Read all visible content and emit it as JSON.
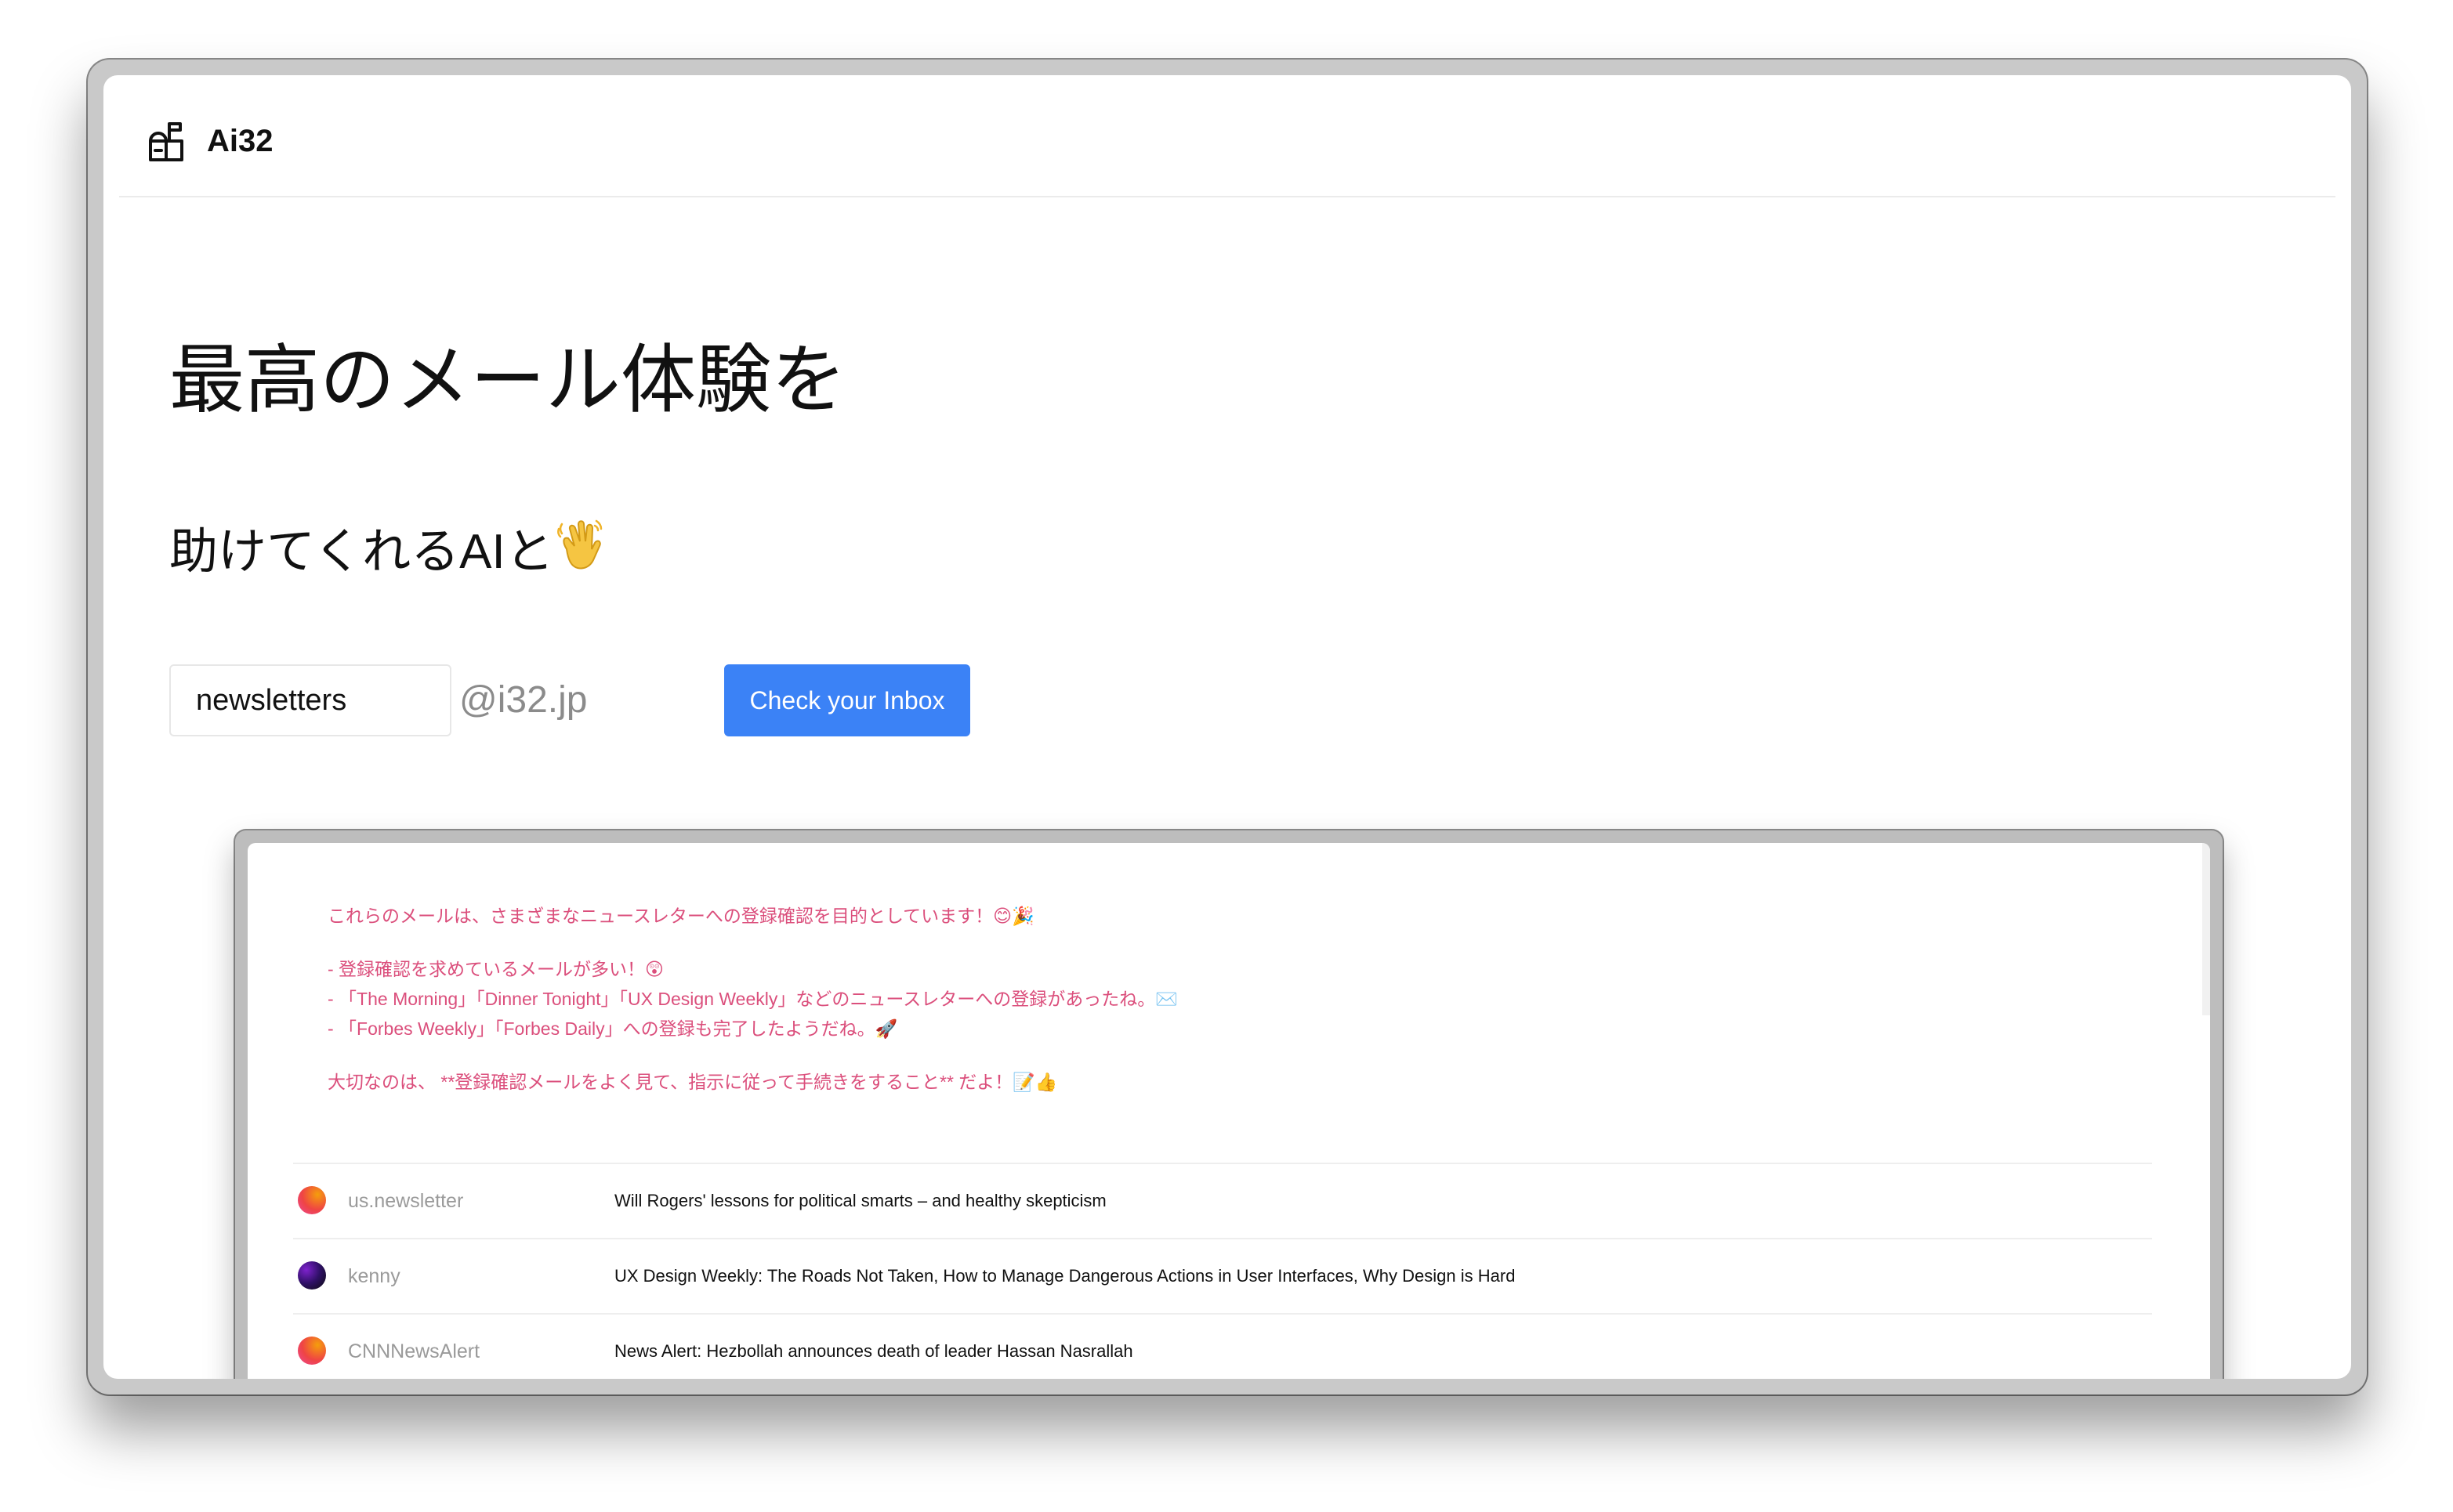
{
  "app": {
    "logo_text": "Ai32",
    "logo_icon": "mailbox-icon"
  },
  "hero": {
    "title": "最高のメール体験を",
    "subtitle": "助けてくれるAIと",
    "subtitle_emoji": "waving-hand-icon"
  },
  "form": {
    "username_value": "newsletters",
    "domain_suffix": "@i32.jp",
    "button_label": "Check your Inbox",
    "button_color": "#3b82f6"
  },
  "preview": {
    "summary": {
      "intro": "これらのメールは、さまざまなニュースレターへの登録確認を目的としています！😊🎉",
      "bullets": [
        "- 登録確認を求めているメールが多い！😲",
        "- 「The Morning」「Dinner Tonight」「UX Design Weekly」などのニュースレターへの登録があったね。✉️",
        "- 「Forbes Weekly」「Forbes Daily」への登録も完了したようだね。🚀"
      ],
      "closing": "大切なのは、 **登録確認メールをよく見て、指示に従って手続きをすること** だよ！📝👍",
      "text_color": "#db4f7c"
    },
    "emails": [
      {
        "sender": "us.newsletter",
        "subject": "Will Rogers' lessons for political smarts – and healthy skepticism",
        "avatar_colors": [
          "#f59e0b",
          "#ec4899"
        ]
      },
      {
        "sender": "kenny",
        "subject": "UX Design Weekly: The Roads Not Taken, How to Manage Dangerous Actions in User Interfaces, Why Design is Hard",
        "avatar_colors": [
          "#7e22ce",
          "#0b0b0b"
        ]
      },
      {
        "sender": "CNNNewsAlert",
        "subject": "News Alert: Hezbollah announces death of leader Hassan Nasrallah",
        "avatar_colors": [
          "#f59e0b",
          "#ec4899"
        ]
      }
    ]
  }
}
